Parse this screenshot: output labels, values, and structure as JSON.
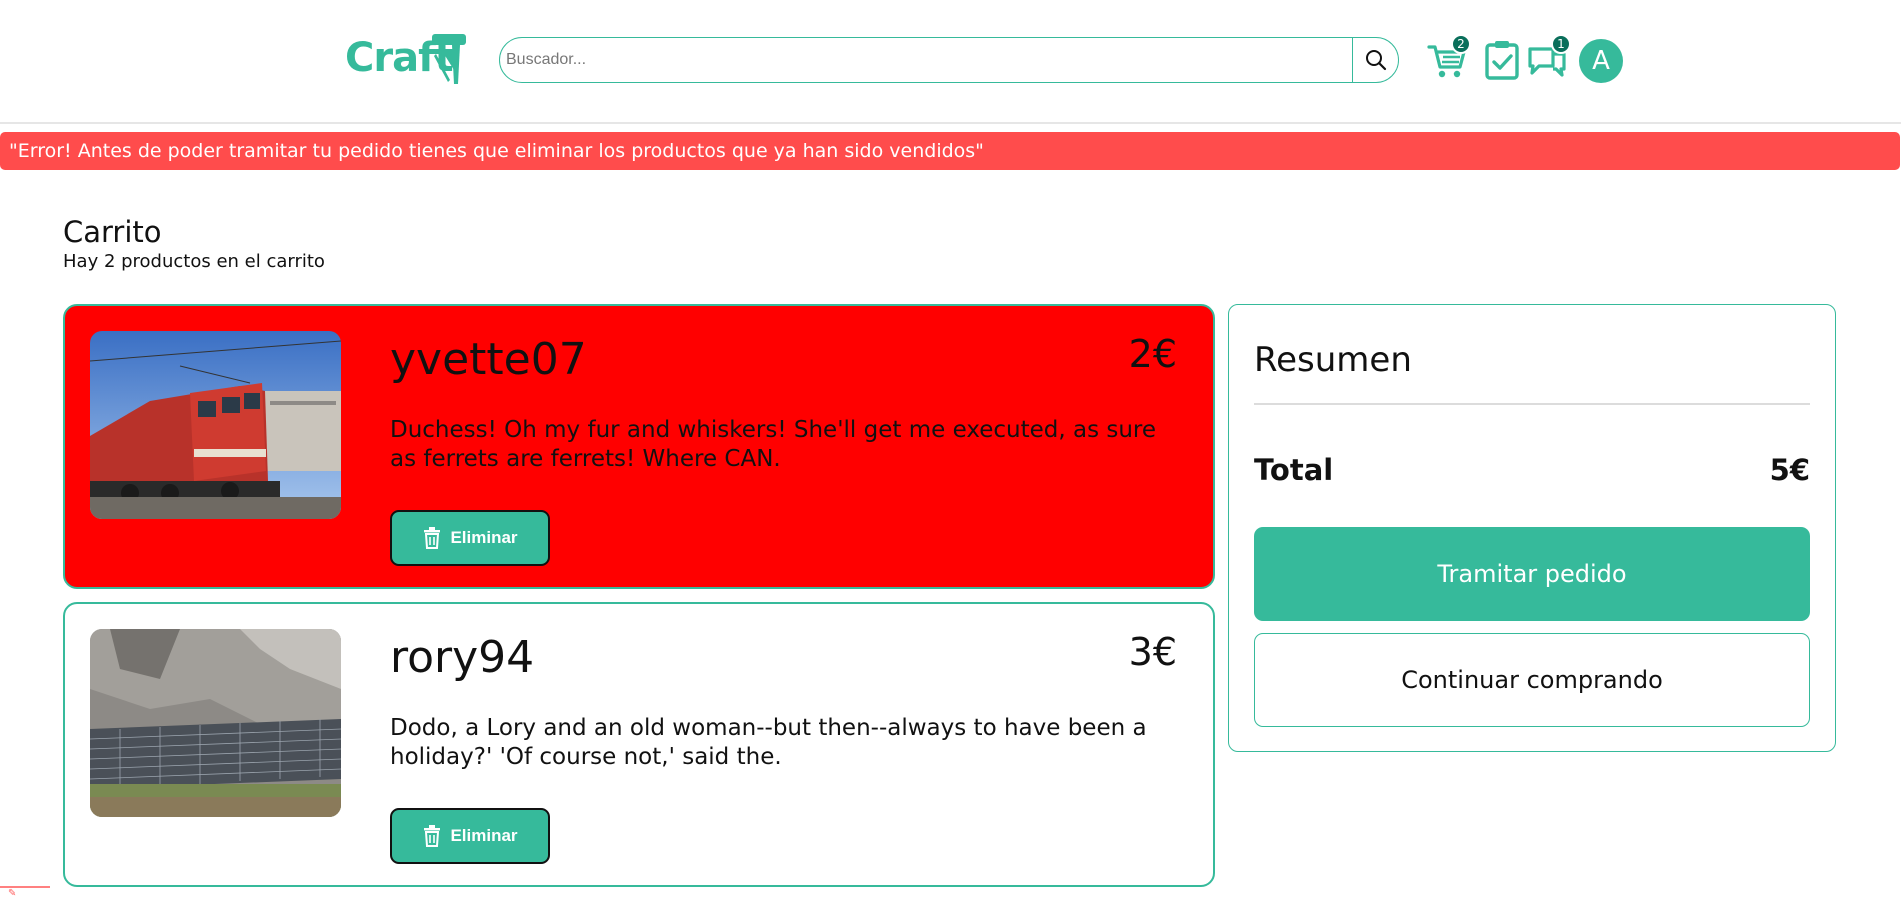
{
  "header": {
    "logo_text": "Craft",
    "search_placeholder": "Buscador...",
    "icons": [
      "cart-icon",
      "orders-icon",
      "messages-icon",
      "search-icon"
    ],
    "cart_badge": "2",
    "messages_badge": "1",
    "avatar_letter": "A"
  },
  "alert": {
    "text": "\"Error! Antes de poder tramitar tu pedido tienes que eliminar los productos que ya han sido vendidos\"",
    "color": "#ff4c4c"
  },
  "cart": {
    "title": "Carrito",
    "subtitle": "Hay 2 productos en el carrito",
    "items": [
      {
        "name": "yvette07",
        "price": "2€",
        "description": "Duchess! Oh my fur and whiskers! She'll get me executed, as sure as ferrets are ferrets! Where CAN.",
        "delete_label": "Eliminar",
        "sold": true,
        "image": "red-train-photo"
      },
      {
        "name": "rory94",
        "price": "3€",
        "description": "Dodo, a Lory and an old woman--but then--always to have been a holiday?' 'Of course not,' said the.",
        "delete_label": "Eliminar",
        "sold": false,
        "image": "solar-panels-cliff-photo"
      }
    ]
  },
  "summary": {
    "title": "Resumen",
    "total_label": "Total",
    "total_value": "5€",
    "checkout_label": "Tramitar pedido",
    "continue_label": "Continuar comprando"
  },
  "colors": {
    "accent": "#36ba9b",
    "badge": "#0a6f5b",
    "sold_item": "#ff0000"
  }
}
